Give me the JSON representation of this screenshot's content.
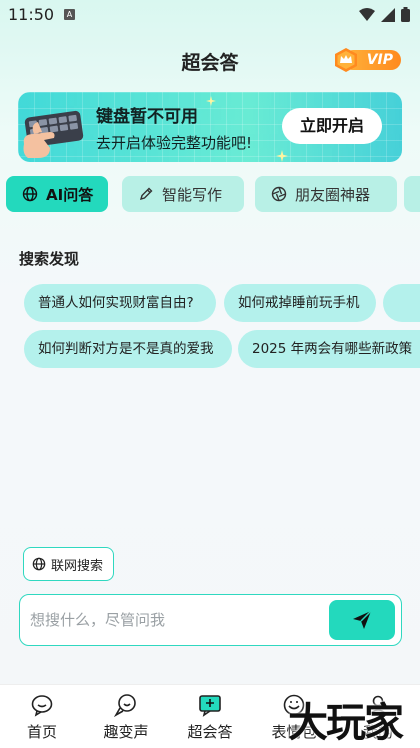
{
  "status_bar": {
    "time": "11:50",
    "notif_icon": "A"
  },
  "header": {
    "title": "超会答",
    "vip_label": "VIP"
  },
  "banner": {
    "title": "键盘暂不可用",
    "subtitle": "去开启体验完整功能吧!",
    "button_label": "立即开启"
  },
  "tabs": [
    {
      "label": "AI问答",
      "icon": "globe-icon",
      "active": true
    },
    {
      "label": "智能写作",
      "icon": "pencil-icon",
      "active": false
    },
    {
      "label": "朋友圈神器",
      "icon": "aperture-icon",
      "active": false
    }
  ],
  "discover": {
    "title": "搜索发现",
    "row1": [
      "普通人如何实现财富自由?",
      "如何戒掉睡前玩手机"
    ],
    "row2": [
      "如何判断对方是不是真的爱我",
      "2025 年两会有哪些新政策"
    ]
  },
  "web_search": {
    "label": "联网搜索"
  },
  "input": {
    "placeholder": "想搜什么，尽管问我"
  },
  "bottom_nav": [
    {
      "label": "首页",
      "icon": "home-chat-icon"
    },
    {
      "label": "趣变声",
      "icon": "voice-change-icon"
    },
    {
      "label": "超会答",
      "icon": "answer-icon"
    },
    {
      "label": "表情包",
      "icon": "emoji-icon"
    },
    {
      "label": "我的",
      "icon": "profile-icon"
    }
  ],
  "watermark": "大玩家",
  "colors": {
    "accent": "#23d9bd",
    "chip_bg": "#b4f1ec",
    "vip_orange": "#ff9a2a"
  }
}
